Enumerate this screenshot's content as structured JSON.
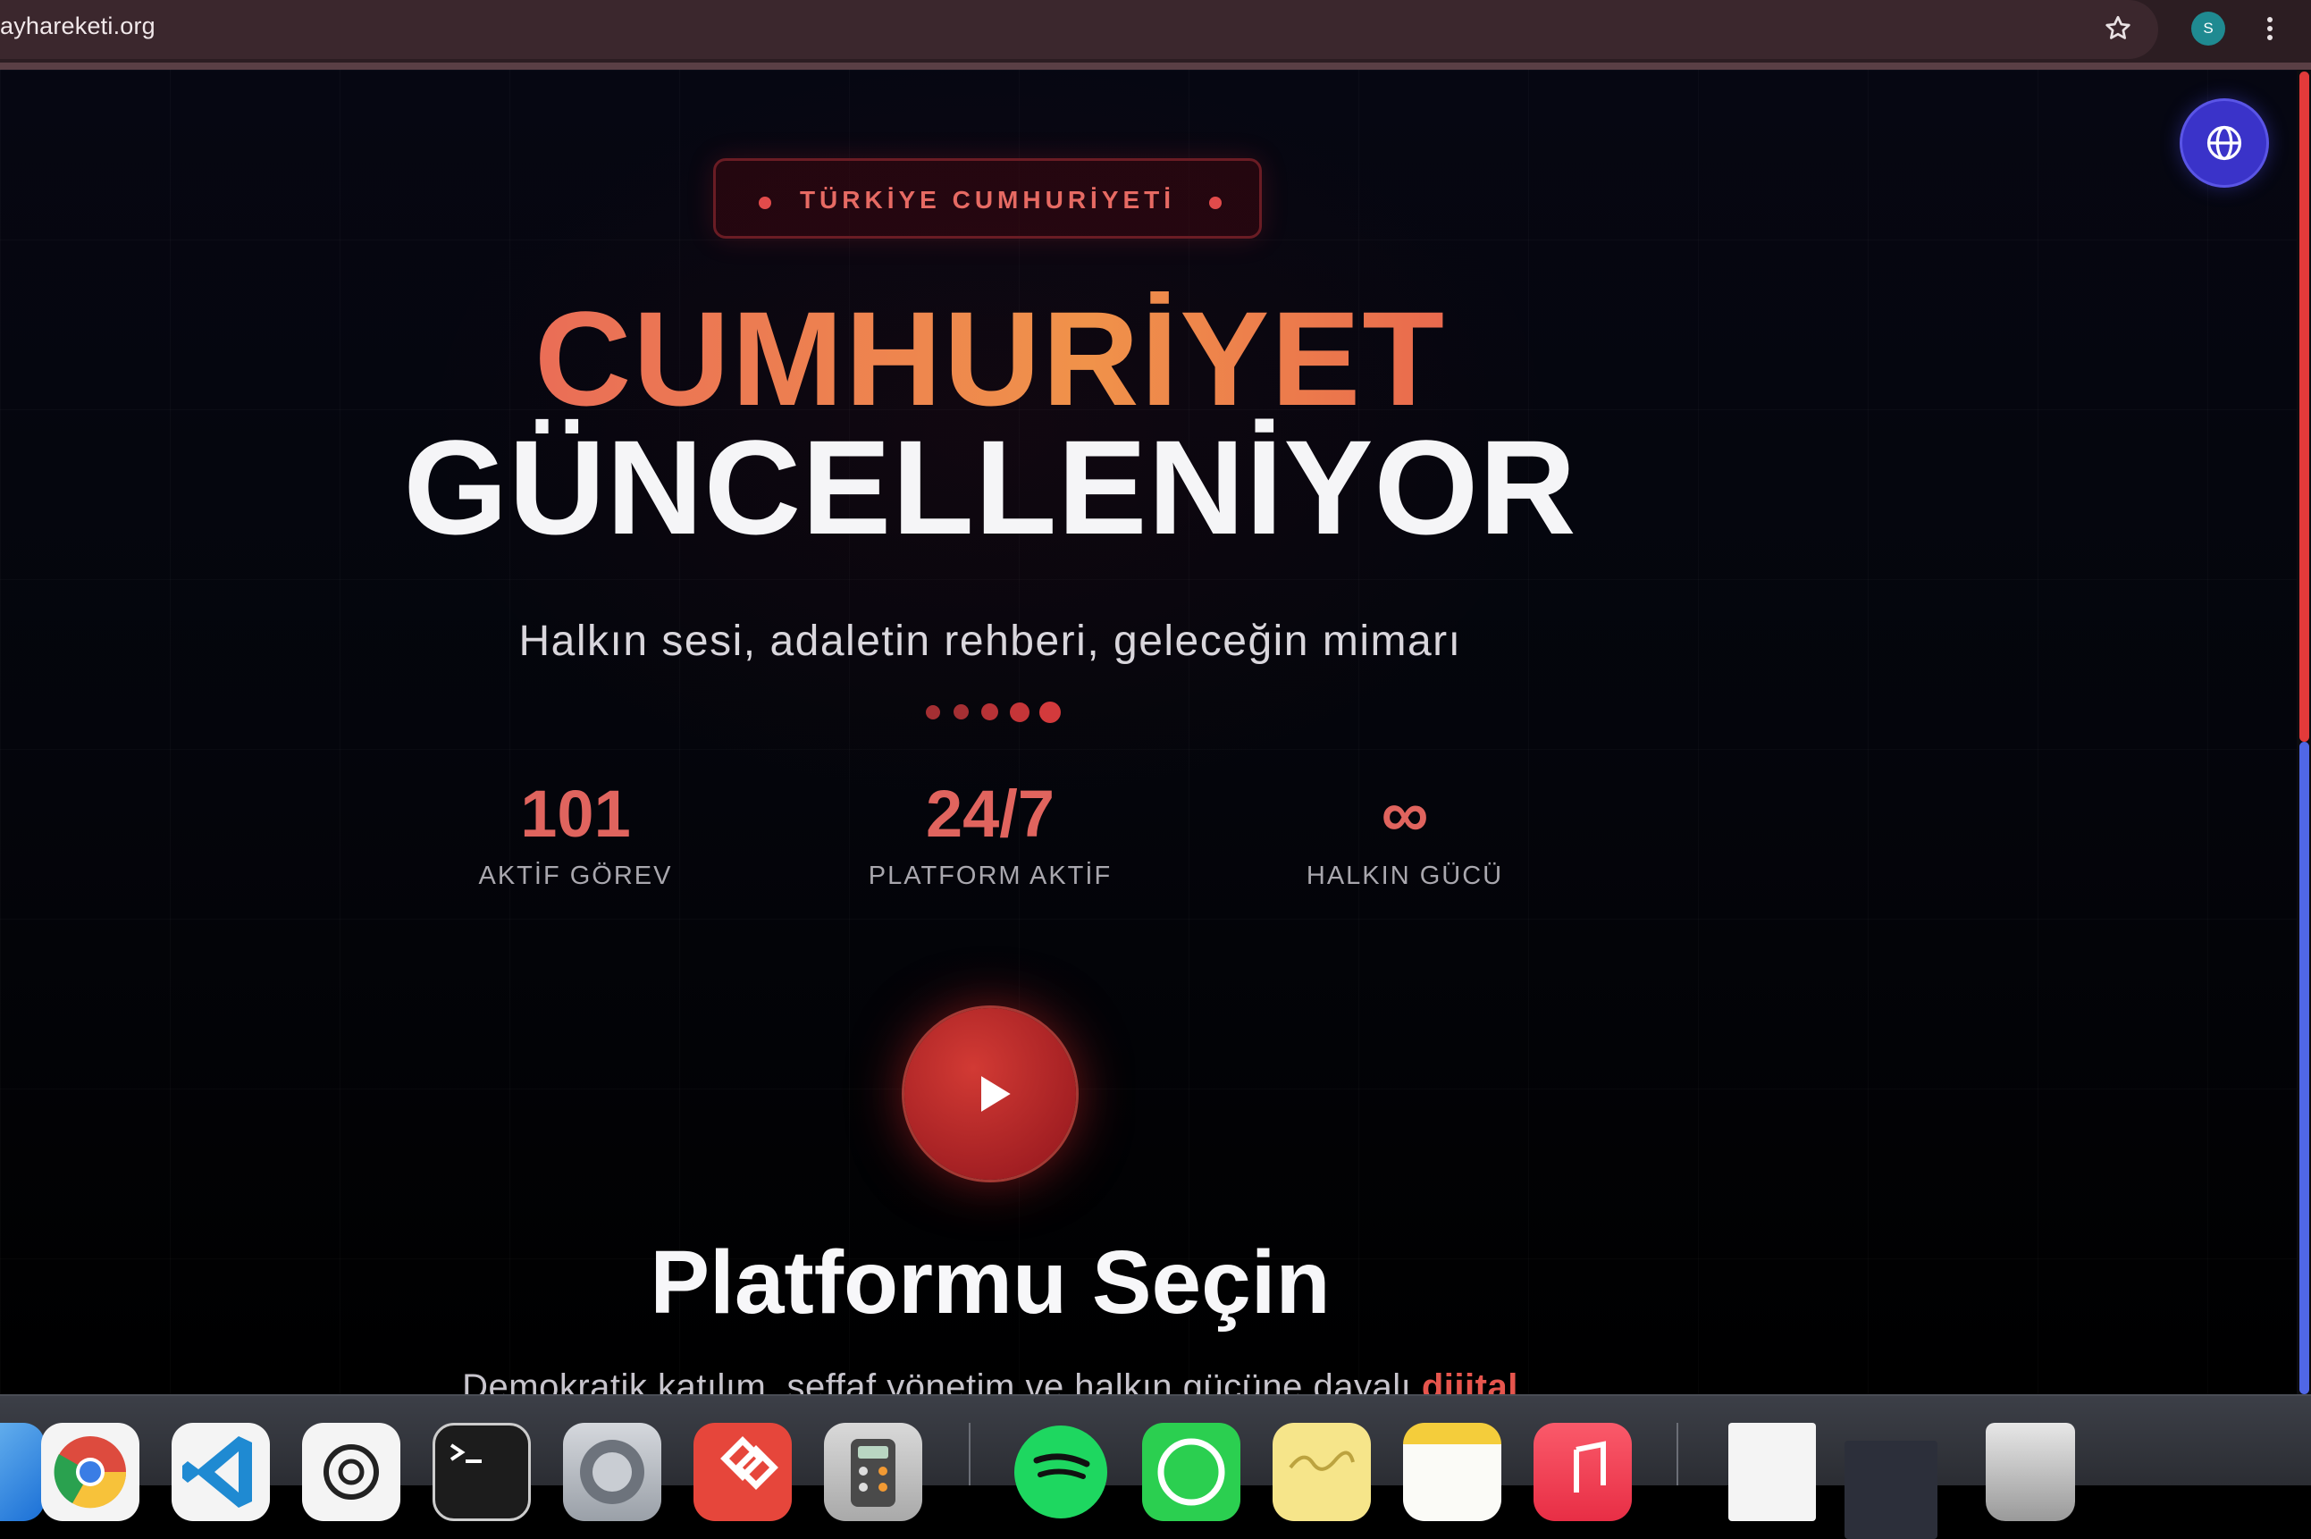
{
  "browser": {
    "url": "ayhareketi.org",
    "profile_initial": "S"
  },
  "page": {
    "badge": "TÜRKİYE CUMHURİYETİ",
    "hero_line1": "CUMHURİYET",
    "hero_line2": "GÜNCELLENİYOR",
    "subtitle": "Halkın sesi, adaletin rehberi, geleceğin mimarı",
    "stats": [
      {
        "value": "101",
        "label": "AKTİF GÖREV"
      },
      {
        "value": "24/7",
        "label": "PLATFORM AKTİF"
      },
      {
        "value": "∞",
        "label": "HALKIN GÜCÜ"
      }
    ],
    "section_title": "Platformu Seçin",
    "section_desc": "Demokratik katılım, şeffaf yönetim ve halkın gücüne dayalı",
    "section_desc_highlight": "dijital"
  },
  "dock": {
    "apps": [
      "finder-icon",
      "chrome-icon",
      "vscode-icon",
      "chatgpt-icon",
      "terminal-icon",
      "system-settings-icon",
      "anydesk-icon",
      "calculator-icon",
      "spotify-icon",
      "whatsapp-icon",
      "stickies-icon",
      "notes-icon",
      "music-icon",
      "recent-document-icon",
      "recent-window-icon",
      "trash-icon"
    ]
  },
  "colors": {
    "accent_red": "#e0645e",
    "lang_button": "#3a33c9",
    "background": "#05060d"
  }
}
